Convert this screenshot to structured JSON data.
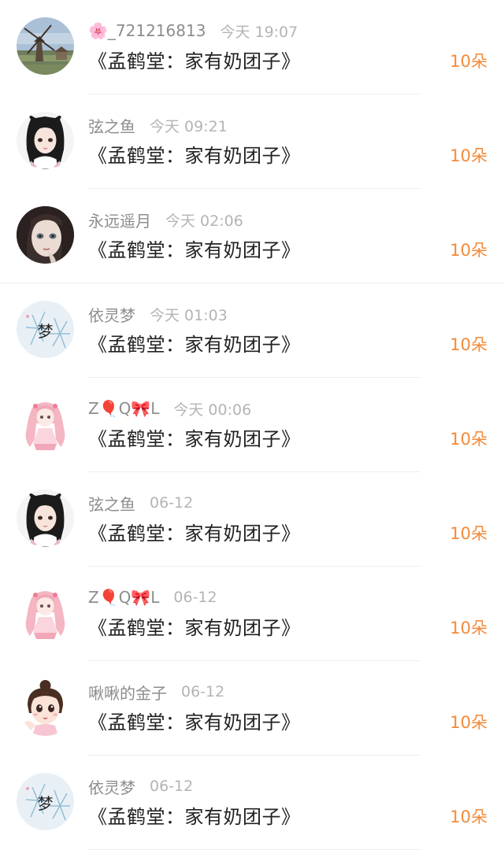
{
  "gift_list": {
    "items": [
      {
        "user": "🌸_721216813",
        "time": "今天 19:07",
        "title": "《孟鹤堂：家有奶团子》",
        "count": "10朵"
      },
      {
        "user": "弦之鱼",
        "time": "今天 09:21",
        "title": "《孟鹤堂：家有奶团子》",
        "count": "10朵"
      },
      {
        "user": "永远遥月",
        "time": "今天 02:06",
        "title": "《孟鹤堂：家有奶团子》",
        "count": "10朵"
      },
      {
        "user": "依灵梦",
        "time": "今天 01:03",
        "title": "《孟鹤堂：家有奶团子》",
        "count": "10朵"
      },
      {
        "user": "Z🎈Q🎀L",
        "time": "今天 00:06",
        "title": "《孟鹤堂：家有奶团子》",
        "count": "10朵"
      },
      {
        "user": "弦之鱼",
        "time": "06-12",
        "title": "《孟鹤堂：家有奶团子》",
        "count": "10朵"
      },
      {
        "user": "Z🎈Q🎀L",
        "time": "06-12",
        "title": "《孟鹤堂：家有奶团子》",
        "count": "10朵"
      },
      {
        "user": "啾啾的金子",
        "time": "06-12",
        "title": "《孟鹤堂：家有奶团子》",
        "count": "10朵"
      },
      {
        "user": "依灵梦",
        "time": "06-12",
        "title": "《孟鹤堂：家有奶团子》",
        "count": "10朵"
      }
    ],
    "avatar_text": {
      "dream": "梦"
    }
  },
  "colors": {
    "count": "#f28a3a",
    "username": "#8d8d8d",
    "time": "#b4b4b4",
    "title": "#222222"
  }
}
